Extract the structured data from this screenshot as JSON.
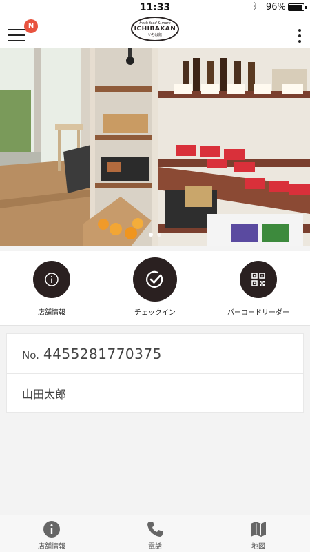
{
  "status_bar": {
    "time": "11:33",
    "battery": "96%",
    "battery_level": 0.96
  },
  "header": {
    "notification_badge": "N",
    "logo": {
      "top": "fresh food & more",
      "main": "ICHIBAKAN",
      "sub": "いちば館"
    },
    "badge_color": "#e8533f"
  },
  "carousel": {
    "slide_count": 2,
    "active_index": 0
  },
  "actions": [
    {
      "label": "店舗情報",
      "icon": "info-icon"
    },
    {
      "label": "チェックイン",
      "icon": "check-icon"
    },
    {
      "label": "バーコードリーダー",
      "icon": "qr-code-icon"
    }
  ],
  "member": {
    "no_label": "No.",
    "number": "4455281770375",
    "name": "山田太郎"
  },
  "tabbar": [
    {
      "label": "店舗情報",
      "icon": "info-icon"
    },
    {
      "label": "電話",
      "icon": "phone-icon"
    },
    {
      "label": "地図",
      "icon": "map-icon"
    }
  ],
  "colors": {
    "accent": "#2a2020",
    "badge": "#e8533f",
    "background": "#f3f3f3"
  }
}
